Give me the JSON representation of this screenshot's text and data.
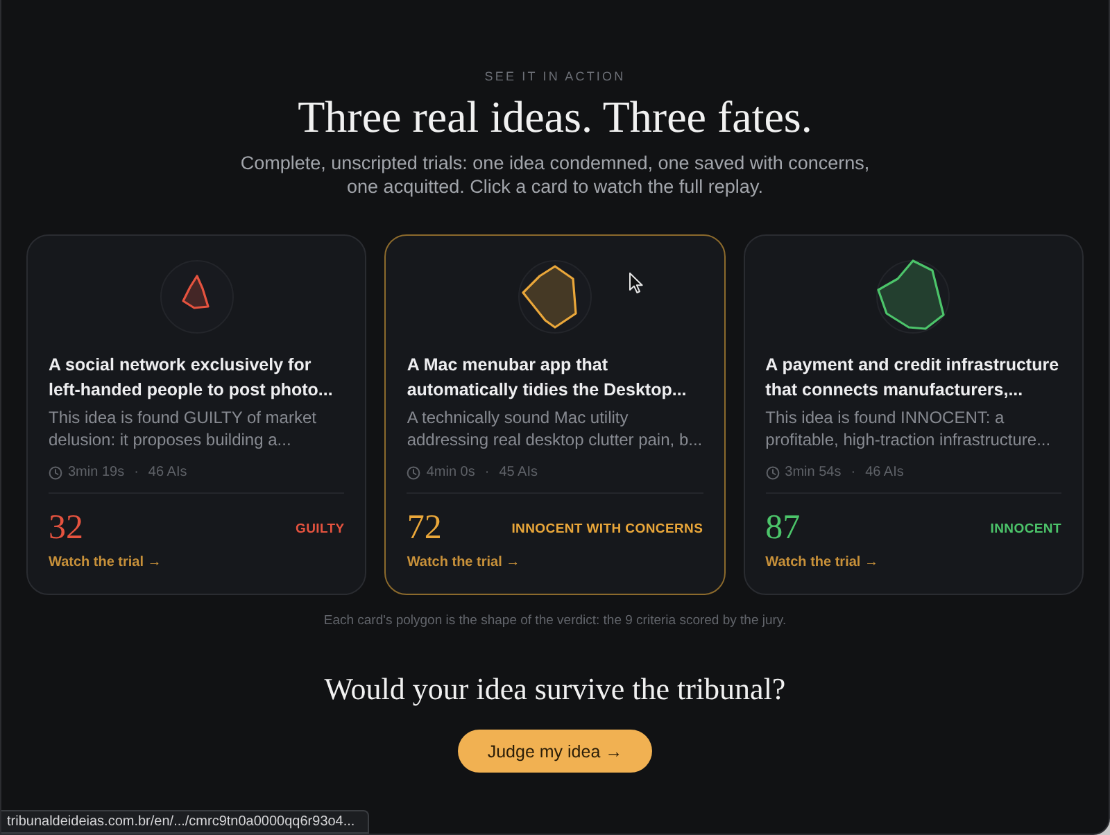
{
  "eyebrow": "SEE IT IN ACTION",
  "title": "Three real ideas. Three fates.",
  "subtitle": "Complete, unscripted trials: one idea condemned, one saved with concerns, one acquitted. Click a card to watch the full replay.",
  "cards": [
    {
      "title": "A social network exclusively for left-handed people to post photo...",
      "summary": "This idea is found GUILTY of market delusion: it proposes building a...",
      "duration": "3min 19s",
      "separator": "·",
      "jurors": "46 AIs",
      "score": "32",
      "verdict": "GUILTY",
      "color": "#e5533f",
      "link": "Watch the trial →",
      "highlighted": false
    },
    {
      "title": "A Mac menubar app that automatically tidies the Desktop...",
      "summary": "A technically sound Mac utility addressing real desktop clutter pain, b...",
      "duration": "4min 0s",
      "separator": "·",
      "jurors": "45 AIs",
      "score": "72",
      "verdict": "INNOCENT WITH CONCERNS",
      "color": "#eaa73a",
      "link": "Watch the trial →",
      "highlighted": true
    },
    {
      "title": "A payment and credit infrastructure that connects manufacturers,...",
      "summary": "This idea is found INNOCENT: a profitable, high-traction infrastructure...",
      "duration": "3min 54s",
      "separator": "·",
      "jurors": "46 AIs",
      "score": "87",
      "verdict": "INNOCENT",
      "color": "#4cc46a",
      "link": "Watch the trial →",
      "highlighted": false
    }
  ],
  "footnote": "Each card's polygon is the shape of the verdict: the 9 criteria scored by the jury.",
  "cta": {
    "heading": "Would your idea survive the tribunal?",
    "button": "Judge my idea →"
  },
  "status_bar": {
    "url": "tribunaldeideias.com.br/en/.../cmrc9tn0a0000qq6r93o4..."
  }
}
